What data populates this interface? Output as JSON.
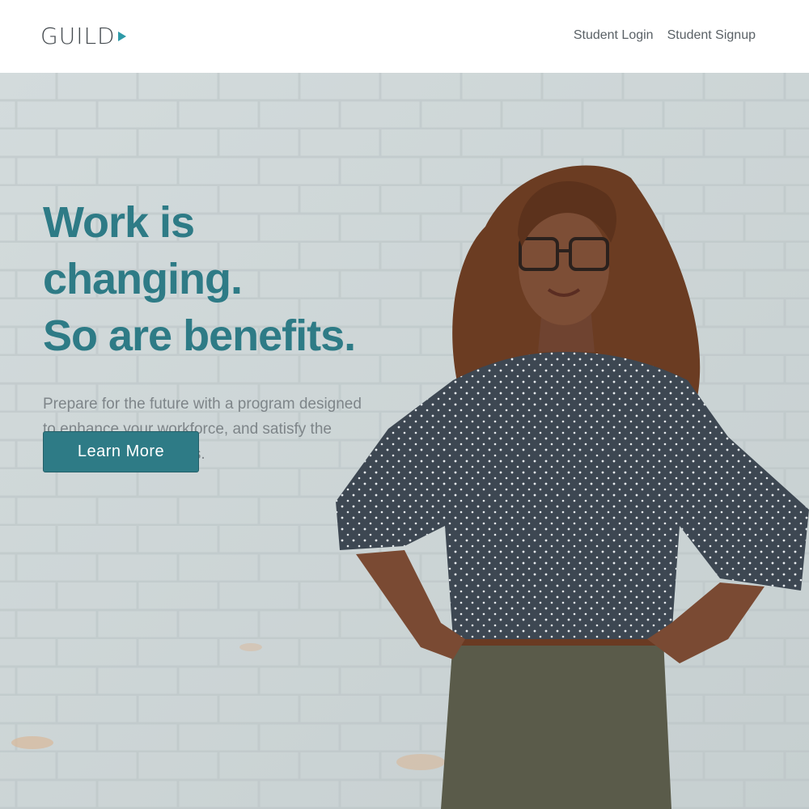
{
  "header": {
    "logo_text": "GUILD",
    "nav": [
      {
        "label": "Student Login"
      },
      {
        "label": "Student Signup"
      }
    ]
  },
  "hero": {
    "headline_line1": "Work is changing.",
    "headline_line2": "So are benefits.",
    "subtext": "Prepare for the future with a program designed to enhance your workforce, and satisfy the needs of your business.",
    "cta_label": "Learn More",
    "image_subject": "woman-portrait-photo"
  },
  "colors": {
    "brand_teal": "#2e7b86",
    "wall": "#cdd6d7",
    "nav_text": "#5a6166",
    "body_text": "#7e8589"
  }
}
